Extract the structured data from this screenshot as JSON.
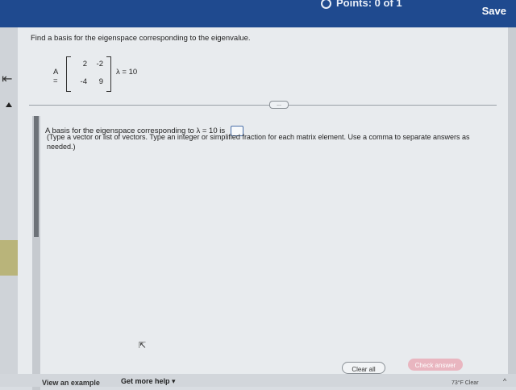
{
  "header": {
    "points_label": "Points: 0 of 1",
    "save_label": "Save"
  },
  "question": {
    "prompt": "Find a basis for the eigenspace corresponding to the eigenvalue.",
    "matrix_label": "A =",
    "matrix": {
      "r1c1": "2",
      "r1c2": "-2",
      "r2c1": "-4",
      "r2c2": "9"
    },
    "eigenvalue": "λ = 10"
  },
  "answer": {
    "prompt": "A basis for the eigenspace corresponding to λ = 10 is",
    "hint": "(Type a vector or list of vectors. Type an integer or simplified fraction for each matrix element. Use a comma to separate answers as needed.)"
  },
  "buttons": {
    "more": "...",
    "clear_all": "Clear all",
    "check_answer": "Check answer",
    "view_example": "View an example",
    "get_more_help": "Get more help ▾"
  },
  "taskbar": {
    "weather": "73°F Clear"
  },
  "icons": {
    "back": "back-arrow-icon",
    "cursor": "mouse-cursor-icon"
  },
  "colors": {
    "header_bg": "#1f4a8f",
    "check_answer_bg": "#e9b6c0"
  }
}
